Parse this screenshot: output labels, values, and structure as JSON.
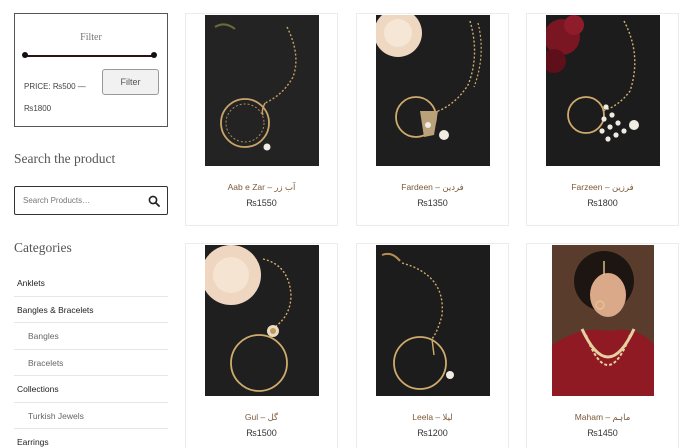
{
  "filter": {
    "title": "Filter",
    "price_label": "PRICE: ₨500 — ₨1800",
    "button_label": "Filter"
  },
  "search": {
    "heading": "Search the product",
    "placeholder": "Search Products…"
  },
  "categories": {
    "heading": "Categories",
    "items": [
      {
        "label": "Anklets",
        "level": "top"
      },
      {
        "label": "Bangles & Bracelets",
        "level": "top"
      },
      {
        "label": "Bangles",
        "level": "sub"
      },
      {
        "label": "Bracelets",
        "level": "sub"
      },
      {
        "label": "Collections",
        "level": "top"
      },
      {
        "label": "Turkish Jewels",
        "level": "sub"
      },
      {
        "label": "Earrings",
        "level": "top"
      }
    ]
  },
  "products": [
    {
      "name": "Aab e Zar – آب زر",
      "price": "₨1550",
      "image": "nath-dark"
    },
    {
      "name": "Fardeen – فردین",
      "price": "₨1350",
      "image": "nath-flower"
    },
    {
      "name": "Farzeen – فرزین",
      "price": "₨1800",
      "image": "nath-roses"
    },
    {
      "name": "Gul – گل",
      "price": "₨1500",
      "image": "nath-flower"
    },
    {
      "name": "Leela – لیلا",
      "price": "₨1200",
      "image": "nath-dark"
    },
    {
      "name": "Maham – ماہم",
      "price": "₨1450",
      "image": "bride-portrait"
    }
  ]
}
